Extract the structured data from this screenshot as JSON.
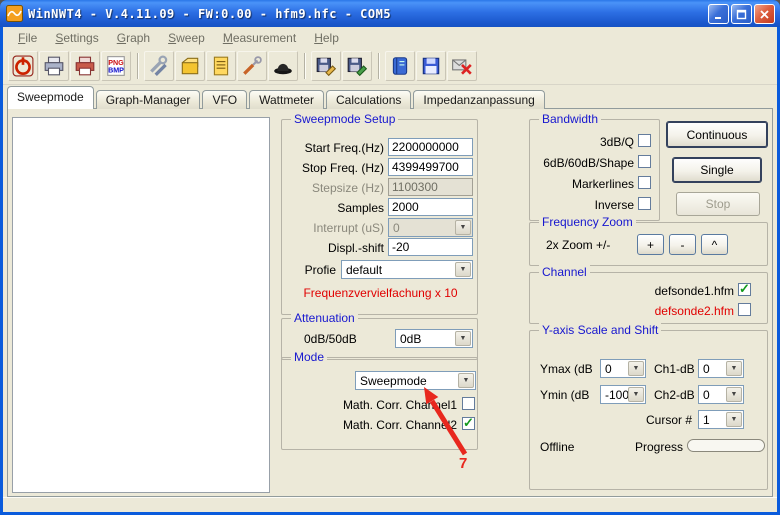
{
  "window": {
    "title": "WinNWT4 - V.4.11.09 - FW:0.00 - hfm9.hfc - COM5",
    "controls": [
      "minimize",
      "maximize",
      "close"
    ]
  },
  "menu": {
    "items": [
      {
        "key": "F",
        "rest": "ile"
      },
      {
        "key": "S",
        "rest": "ettings"
      },
      {
        "key": "G",
        "rest": "raph"
      },
      {
        "key": "S",
        "rest": "weep"
      },
      {
        "key": "M",
        "rest": "easurement"
      },
      {
        "key": "H",
        "rest": "elp"
      }
    ]
  },
  "toolbar": {
    "icons": [
      "power-off",
      "printer",
      "printer-color",
      "export-png-bmp",
      "tools-wrench",
      "component-box",
      "log-list",
      "service-tools",
      "calibration-hat",
      "save-edit-1",
      "save-edit-2",
      "notebook",
      "save-disk",
      "mail-delete"
    ]
  },
  "tabs": {
    "active": "Sweepmode",
    "items": [
      "Sweepmode",
      "Graph-Manager",
      "VFO",
      "Wattmeter",
      "Calculations",
      "Impedanzanpassung"
    ]
  },
  "setup": {
    "title": "Sweepmode Setup",
    "rows": {
      "start": {
        "label": "Start Freq.(Hz)",
        "value": "2200000000"
      },
      "stop": {
        "label": "Stop Freq. (Hz)",
        "value": "4399499700"
      },
      "step": {
        "label": "Stepsize (Hz)",
        "value": "1100300"
      },
      "samples": {
        "label": "Samples",
        "value": "2000"
      },
      "interrupt": {
        "label": "Interrupt (uS)",
        "value": "0"
      },
      "shift": {
        "label": "Displ.-shift",
        "value": "-20"
      },
      "profile": {
        "label": "Profie",
        "value": "default"
      }
    },
    "note": "Frequenzvervielfachung x 10"
  },
  "attenuation": {
    "title": "Attenuation",
    "label": "0dB/50dB",
    "value": "0dB"
  },
  "mode": {
    "title": "Mode",
    "combo_value": "Sweepmode",
    "ch1_label": "Math. Corr. Channel1",
    "ch1_check": "",
    "ch2_label": "Math. Corr. Channel2",
    "ch2_check": "✓"
  },
  "bandwidth": {
    "title": "Bandwidth",
    "options": [
      {
        "label": "3dB/Q",
        "check": ""
      },
      {
        "label": "6dB/60dB/Shape",
        "check": ""
      },
      {
        "label": "Markerlines",
        "check": ""
      },
      {
        "label": "Inverse",
        "check": ""
      }
    ]
  },
  "actions": {
    "continuous": "Continuous",
    "single": "Single",
    "stop": "Stop"
  },
  "zoom": {
    "title": "Frequency Zoom",
    "label": "2x Zoom +/-",
    "plus": "+",
    "minus": "-",
    "caret": "^"
  },
  "channel": {
    "title": "Channel",
    "items": [
      {
        "label": "defsonde1.hfm",
        "check": "✓",
        "color": "#000000"
      },
      {
        "label": "defsonde2.hfm",
        "check": "",
        "color": "#ff0000"
      }
    ]
  },
  "yaxis": {
    "title": "Y-axis Scale and Shift",
    "ymax_label": "Ymax (dB",
    "ymax_value": "0",
    "ch1_label": "Ch1-dB",
    "ch1_value": "0",
    "ymin_label": "Ymin (dB",
    "ymin_value": "-100",
    "ch2_label": "Ch2-dB",
    "ch2_value": "0",
    "cursor_label": "Cursor #",
    "cursor_value": "1",
    "offline": "Offline",
    "progress": "Progress"
  },
  "annotation": {
    "label": "7",
    "color": "#e8281e"
  },
  "colors": {
    "titlebar_blue": "#2a72ec",
    "group_title_blue": "#1717cf",
    "note_red": "#e00000",
    "check_green": "#14991c"
  }
}
